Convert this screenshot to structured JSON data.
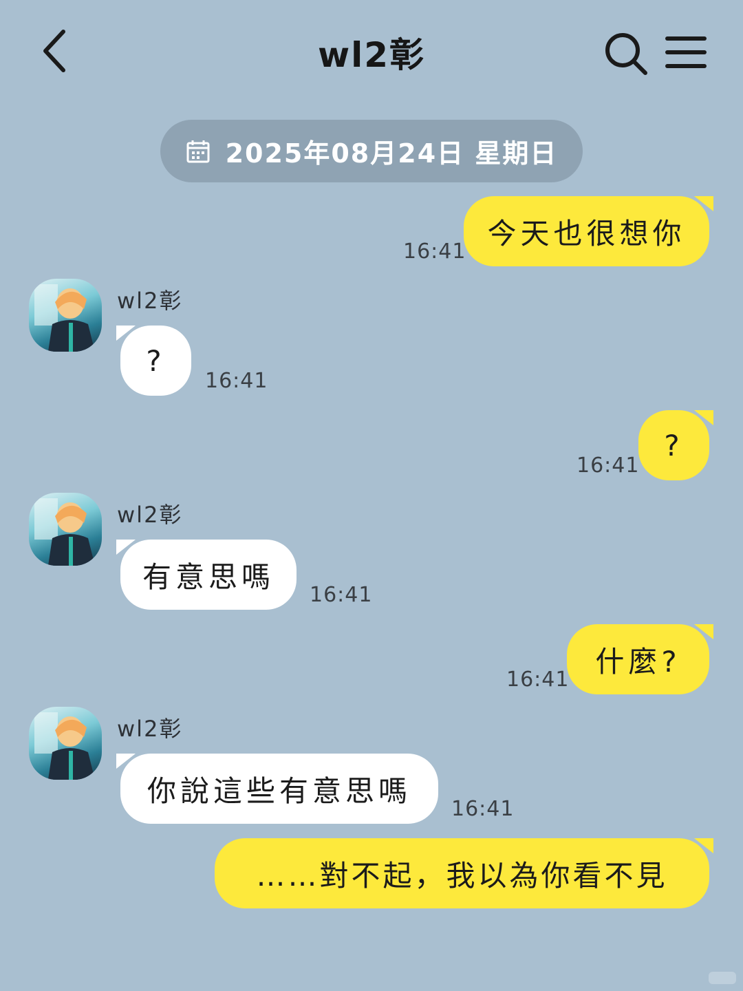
{
  "header": {
    "title": "wl2彰",
    "back_icon": "chevron-left-icon",
    "search_icon": "search-icon",
    "menu_icon": "menu-icon"
  },
  "date_divider": {
    "icon": "calendar-icon",
    "text": "2025年08月24日 星期日"
  },
  "contact": {
    "name": "wl2彰"
  },
  "messages": [
    {
      "direction": "out",
      "text": "今天也很想你",
      "time": "16:41"
    },
    {
      "direction": "in",
      "sender": "wl2彰",
      "text": "?",
      "time": "16:41"
    },
    {
      "direction": "out",
      "text": "?",
      "time": "16:41"
    },
    {
      "direction": "in",
      "sender": "wl2彰",
      "text": "有意思嗎",
      "time": "16:41"
    },
    {
      "direction": "out",
      "text": "什麼?",
      "time": "16:41"
    },
    {
      "direction": "in",
      "sender": "wl2彰",
      "text": "你說這些有意思嗎",
      "time": "16:41"
    },
    {
      "direction": "out",
      "text": "……對不起，我以為你看不見",
      "time": ""
    }
  ],
  "colors": {
    "background": "#a9bfd0",
    "outgoing_bubble": "#fde93c",
    "incoming_bubble": "#ffffff",
    "date_pill": "#8fa3b3"
  }
}
